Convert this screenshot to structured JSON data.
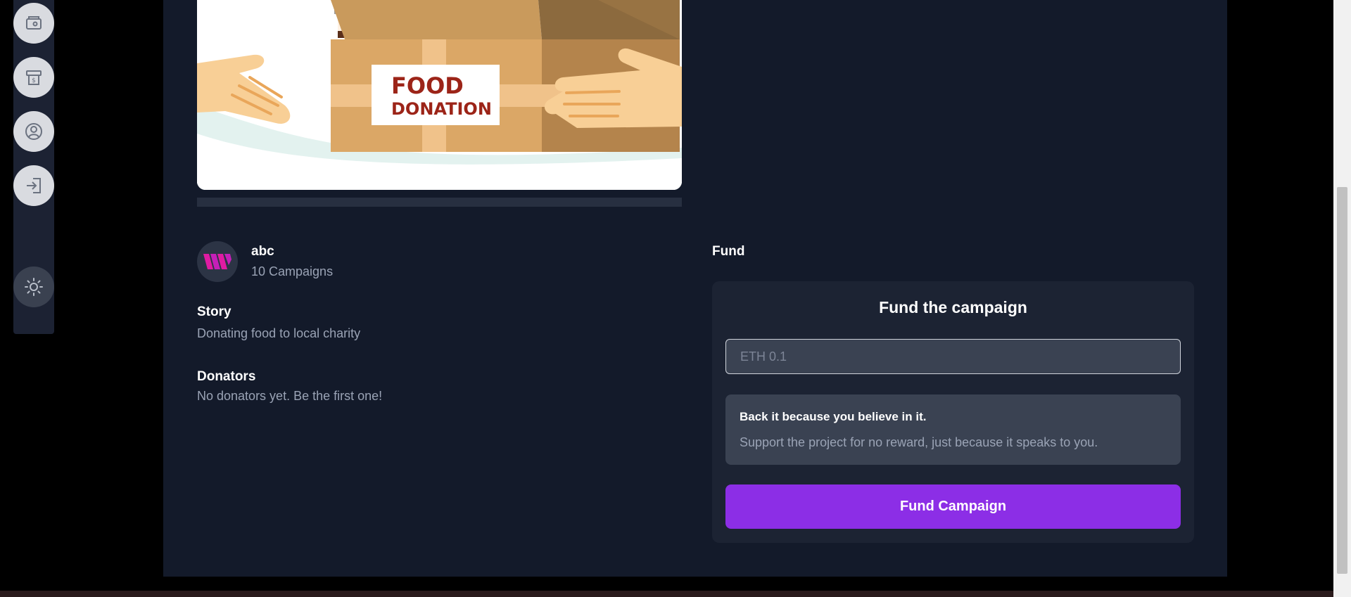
{
  "sidebar": {
    "icons": [
      "wallet-icon",
      "payment-icon",
      "profile-icon",
      "logout-icon",
      "theme-toggle-icon"
    ]
  },
  "hero": {
    "sign_line1": "FOOD",
    "sign_line2": "DONATION"
  },
  "progress": {
    "fraction": 0.0
  },
  "creator": {
    "name": "abc",
    "campaigns": "10 Campaigns"
  },
  "story": {
    "title": "Story",
    "text": "Donating food to local charity"
  },
  "donators": {
    "title": "Donators",
    "text": "No donators yet. Be the first one!"
  },
  "fund": {
    "heading": "Fund",
    "card_title": "Fund the campaign",
    "input_placeholder": "ETH 0.1",
    "note_title": "Back it because you believe in it.",
    "note_text": "Support the project for no reward, just because it speaks to you.",
    "button_label": "Fund Campaign"
  },
  "colors": {
    "background": "#131a2a",
    "card": "#1c2333",
    "accent": "#8c2ee6",
    "muted_text": "#9aa3b5"
  }
}
